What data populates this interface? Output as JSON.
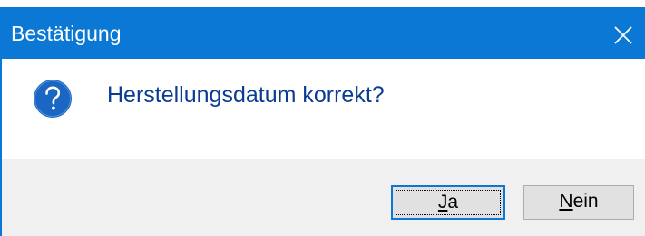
{
  "dialog": {
    "title": "Bestätigung",
    "message": "Herstellungsdatum korrekt?",
    "icon": "question-icon",
    "buttons": {
      "yes": {
        "mnemonic": "J",
        "rest": "a"
      },
      "no": {
        "mnemonic": "N",
        "rest": "ein"
      }
    }
  },
  "colors": {
    "titlebar": "#0a78d4",
    "message_text": "#0a3c91",
    "footer": "#f0f0f0",
    "icon_fill": "#1a66c2"
  }
}
